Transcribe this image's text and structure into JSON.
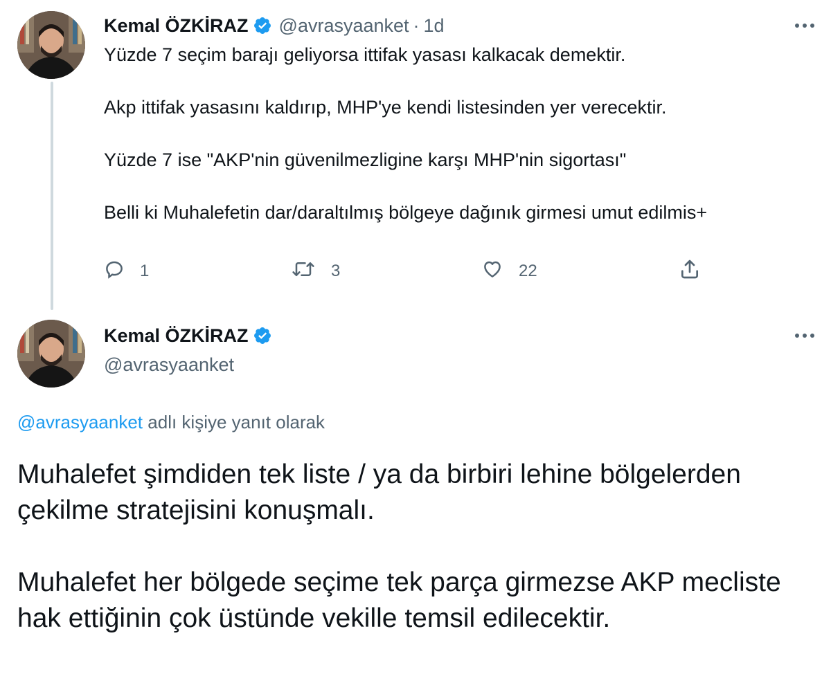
{
  "colors": {
    "text": "#0f1419",
    "secondary": "#536471",
    "link": "#1d9bf0",
    "verified": "#1d9bf0",
    "thread_line": "#cfd9de"
  },
  "tweet1": {
    "avatar_icon": "profile-photo",
    "display_name": "Kemal ÖZKİRAZ",
    "verified_icon": "verified-badge-icon",
    "handle": "@avrasyaanket",
    "separator": "·",
    "time": "1d",
    "more_icon": "more-options-icon",
    "paragraphs": [
      "Yüzde 7 seçim barajı geliyorsa ittifak yasası kalkacak demektir.",
      "Akp ittifak yasasını kaldırıp, MHP'ye kendi listesinden yer verecektir.",
      "Yüzde 7 ise \"AKP'nin güvenilmezligine karşı MHP'nin sigortası\"",
      "Belli ki Muhalefetin dar/daraltılmış bölgeye dağınık girmesi umut edilmis+"
    ],
    "actions": {
      "reply": {
        "icon": "reply-icon",
        "count": "1"
      },
      "retweet": {
        "icon": "retweet-icon",
        "count": "3"
      },
      "like": {
        "icon": "heart-icon",
        "count": "22"
      },
      "share": {
        "icon": "share-icon"
      }
    }
  },
  "tweet2": {
    "avatar_icon": "profile-photo",
    "display_name": "Kemal ÖZKİRAZ",
    "verified_icon": "verified-badge-icon",
    "handle": "@avrasyaanket",
    "more_icon": "more-options-icon",
    "reply_to_handle": "@avrasyaanket",
    "reply_to_text": " adlı kişiye yanıt olarak",
    "paragraphs": [
      "Muhalefet şimdiden tek liste / ya da birbiri lehine bölgelerden çekilme stratejisini konuşmalı.",
      "Muhalefet her bölgede seçime tek parça girmezse AKP mecliste hak ettiğinin çok üstünde vekille temsil edilecektir."
    ]
  }
}
